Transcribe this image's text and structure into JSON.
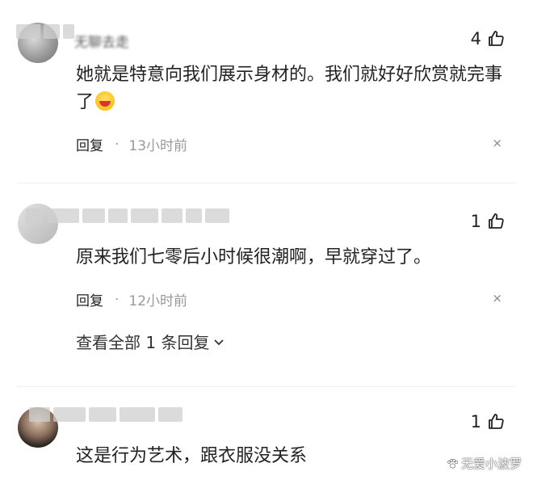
{
  "comments": [
    {
      "username": "无聊去走",
      "likes": "4",
      "text": "她就是特意向我们展示身材的。我们就好好欣赏就完事了",
      "emoji": "laughing-emoji",
      "reply_label": "回复",
      "time": "13小时前"
    },
    {
      "username": "",
      "likes": "1",
      "text": "原来我们七零后小时候很潮啊，早就穿过了。",
      "reply_label": "回复",
      "time": "12小时前",
      "view_replies": "查看全部 1 条回复"
    },
    {
      "username": "",
      "likes": "1",
      "text": "这是行为艺术，跟衣服没关系"
    }
  ],
  "close_glyph": "×",
  "watermark": "无爱小波罗",
  "icons": {
    "like": "thumbs-up-icon",
    "close": "close-icon",
    "expand": "chevron-down-icon",
    "watermark": "paw-icon"
  }
}
